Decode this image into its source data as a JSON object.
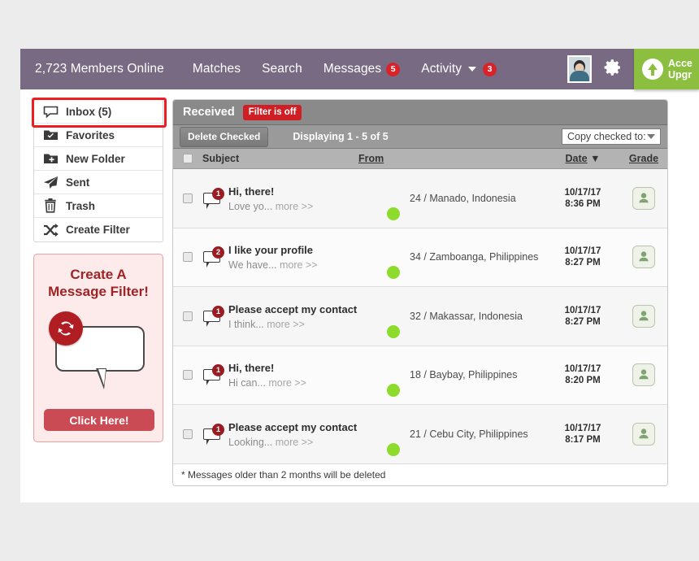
{
  "topnav": {
    "members_online": "2,723 Members Online",
    "items": [
      {
        "label": "Matches",
        "badge": null,
        "caret": false
      },
      {
        "label": "Search",
        "badge": null,
        "caret": false
      },
      {
        "label": "Messages",
        "badge": "5",
        "caret": false
      },
      {
        "label": "Activity",
        "badge": "3",
        "caret": true
      }
    ],
    "avatar_icon": "user-photo-icon",
    "settings_icon": "gear-icon",
    "upgrade_icon": "up-arrow-circle-icon",
    "upgrade_line1": "Acce",
    "upgrade_line2": "Upgr",
    "bar_color": "#786a83",
    "upgrade_color": "#8cbf3f"
  },
  "sidebar": {
    "folders": [
      {
        "label": "Inbox (5)",
        "icon": "speech-bubble-icon",
        "selected": true
      },
      {
        "label": "Favorites",
        "icon": "folder-check-icon",
        "selected": false
      },
      {
        "label": "New Folder",
        "icon": "folder-plus-icon",
        "selected": false
      },
      {
        "label": "Sent",
        "icon": "paper-plane-icon",
        "selected": false
      },
      {
        "label": "Trash",
        "icon": "trash-icon",
        "selected": false
      },
      {
        "label": "Create Filter",
        "icon": "shuffle-icon",
        "selected": false
      }
    ],
    "highlight_color": "#ee1c23"
  },
  "promo": {
    "title_line1": "Create A",
    "title_line2": "Message Filter!",
    "icon": "refresh-icon",
    "button_label": "Click Here!",
    "button_color": "#cb4b55",
    "title_color": "#9f2225"
  },
  "panel": {
    "title": "Received",
    "filter_badge": "Filter is off",
    "filter_badge_color": "#cf1f25",
    "delete_button": "Delete Checked",
    "displaying": "Displaying 1 - 5 of 5",
    "copy_select_value": "Copy checked to:",
    "columns": {
      "subject": "Subject",
      "from": "From",
      "date": "Date",
      "date_sort": "▼",
      "grade": "Grade"
    },
    "footer_note": "* Messages older than 2 months will be deleted",
    "grade_icon": "person-badge-icon",
    "rows": [
      {
        "count": "1",
        "subject": "Hi, there!",
        "preview": "Love yo...",
        "more": "more >>",
        "username_hidden": true,
        "age_location": "24 / Manado, Indonesia",
        "date": "10/17/17",
        "time": "8:36 PM",
        "online": true,
        "avatar_colors": [
          "#4a3f44",
          "#cf3440",
          "#20252b"
        ]
      },
      {
        "count": "2",
        "subject": "I like your profile",
        "preview": "We have...",
        "more": "more >>",
        "username_hidden": true,
        "age_location": "34 / Zamboanga, Philippines",
        "date": "10/17/17",
        "time": "8:27 PM",
        "online": true,
        "avatar_colors": [
          "#9aa7b8",
          "#9c7fb5",
          "#cfc6de"
        ]
      },
      {
        "count": "1",
        "subject": "Please accept my contact",
        "preview": "I think...",
        "more": "more >>",
        "username_hidden": true,
        "age_location": "32 / Makassar, Indonesia",
        "date": "10/17/17",
        "time": "8:27 PM",
        "online": true,
        "avatar_colors": [
          "#e8c49f",
          "#d9762e",
          "#f3e7da"
        ]
      },
      {
        "count": "1",
        "subject": "Hi, there!",
        "preview": "Hi can...",
        "more": "more >>",
        "username_hidden": true,
        "age_location": "18 / Baybay, Philippines",
        "date": "10/17/17",
        "time": "8:20 PM",
        "online": true,
        "avatar_colors": [
          "#6d6f5c",
          "#a8c8d8",
          "#3d3b52"
        ]
      },
      {
        "count": "1",
        "subject": "Please accept my contact",
        "preview": "Looking...",
        "more": "more >>",
        "username_hidden": true,
        "age_location": "21 / Cebu City, Philippines",
        "date": "10/17/17",
        "time": "8:17 PM",
        "online": true,
        "avatar_colors": [
          "#c8546e",
          "#e8a9b4",
          "#f2ccd2"
        ]
      }
    ]
  }
}
